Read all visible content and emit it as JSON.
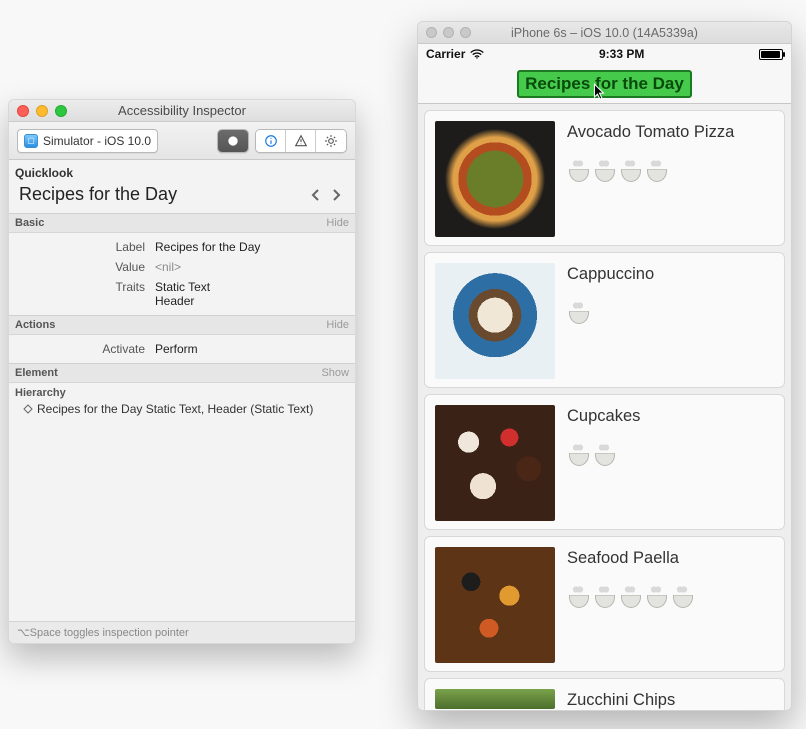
{
  "inspector": {
    "window_title": "Accessibility Inspector",
    "target_label": "Simulator - iOS 10.0",
    "quicklook_label": "Quicklook",
    "quicklook_value": "Recipes for the Day",
    "section_basic": "Basic",
    "section_actions": "Actions",
    "section_element": "Element",
    "toggle_hide": "Hide",
    "toggle_show": "Show",
    "row_label_key": "Label",
    "row_label_val": "Recipes for the Day",
    "row_value_key": "Value",
    "row_value_val": "<nil>",
    "row_traits_key": "Traits",
    "row_traits_val1": "Static Text",
    "row_traits_val2": "Header",
    "row_activate_key": "Activate",
    "row_activate_btn": "Perform",
    "hierarchy_label": "Hierarchy",
    "hierarchy_row": "Recipes for the Day Static Text, Header (Static Text)",
    "statusbar": "⌥Space toggles inspection pointer"
  },
  "simulator": {
    "window_title": "iPhone 6s – iOS 10.0 (14A5339a)",
    "carrier": "Carrier",
    "time": "9:33 PM",
    "app_title": "Recipes for the Day",
    "recipes": {
      "r0": {
        "name": "Avocado Tomato Pizza"
      },
      "r1": {
        "name": "Cappuccino"
      },
      "r2": {
        "name": "Cupcakes"
      },
      "r3": {
        "name": "Seafood Paella"
      },
      "r4": {
        "name": "Zucchini Chips"
      }
    }
  }
}
